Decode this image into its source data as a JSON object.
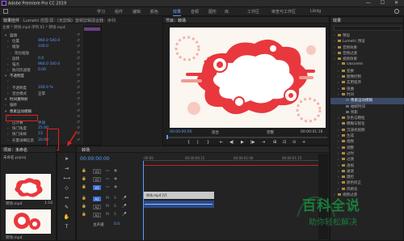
{
  "titlebar": {
    "app_title": "Adobe Premiere Pro CC 2019"
  },
  "workspaces": {
    "items": [
      "学习",
      "组件",
      "编辑",
      "颜色",
      "效果",
      "音频",
      "图形",
      "库",
      "工作区",
      "审查与工作区",
      "Liblig"
    ],
    "active_index": 4
  },
  "effect_controls": {
    "tabs": [
      "效果控件",
      "Lumetri 范围",
      "源：(无剪辑)",
      "音频剪辑混合器：序列"
    ],
    "clip_label": "主要 * 转场.mp4  序列 01 * 转场.mp4",
    "timecode_label": "0:00:00",
    "rows": [
      {
        "indent": 1,
        "label": "运动",
        "value": "",
        "section": true
      },
      {
        "indent": 2,
        "label": "位置",
        "value": "960.0  540.0"
      },
      {
        "indent": 2,
        "label": "缩放",
        "value": "100.0"
      },
      {
        "indent": 3,
        "label": "等比缩放",
        "value": ""
      },
      {
        "indent": 2,
        "label": "旋转",
        "value": "0.0"
      },
      {
        "indent": 2,
        "label": "锚点",
        "value": "960.0  540.0"
      },
      {
        "indent": 2,
        "label": "防闪烁滤镜",
        "value": "0.00"
      },
      {
        "indent": 1,
        "label": "不透明度",
        "value": "",
        "section": true
      },
      {
        "indent": 2,
        "label": "",
        "value": ""
      },
      {
        "indent": 2,
        "label": "不透明度",
        "value": "100.0 %"
      },
      {
        "indent": 2,
        "label": "混合模式",
        "value": "正常"
      },
      {
        "indent": 1,
        "label": "时间重映射",
        "value": "",
        "section": true
      },
      {
        "indent": 1,
        "label": "偏移",
        "value": ""
      },
      {
        "indent": 1,
        "label": "像素运动模糊",
        "value": "",
        "section": true
      },
      {
        "indent": 2,
        "label": "",
        "value": ""
      },
      {
        "indent": 2,
        "label": "已计算",
        "value": "手动"
      },
      {
        "indent": 2,
        "label": "快门角度",
        "value": "25.00"
      },
      {
        "indent": 2,
        "label": "快门采样",
        "value": "23"
      },
      {
        "indent": 2,
        "label": "矢量详细信息",
        "value": "20.00"
      }
    ]
  },
  "program_monitor": {
    "title": "节目：转场",
    "timecode_left": "00:00:00:00",
    "fit_label": "适合",
    "quality_label": "完整",
    "timecode_right": "00:00:01:16",
    "transport": [
      "{",
      "|",
      "}",
      "⇤",
      "◀|",
      "▶",
      "|▶",
      "⇥",
      "⊞",
      "⊡",
      "⊙",
      "+"
    ]
  },
  "effects": {
    "title": "效果",
    "items": [
      {
        "label": "预设",
        "kind": "folder",
        "indent": 0
      },
      {
        "label": "Lumetri 预设",
        "kind": "folder",
        "indent": 0
      },
      {
        "label": "音频效果",
        "kind": "folder",
        "indent": 0
      },
      {
        "label": "音频过渡",
        "kind": "folder",
        "indent": 0
      },
      {
        "label": "视频效果",
        "kind": "folder",
        "indent": 0
      },
      {
        "label": "Obsolete",
        "kind": "folder",
        "indent": 1
      },
      {
        "label": "变换",
        "kind": "folder",
        "indent": 1
      },
      {
        "label": "图像控制",
        "kind": "folder",
        "indent": 1
      },
      {
        "label": "实用程序",
        "kind": "folder",
        "indent": 1
      },
      {
        "label": "扭曲",
        "kind": "folder",
        "indent": 1
      },
      {
        "label": "时间",
        "kind": "folder",
        "indent": 1
      },
      {
        "label": "像素运动模糊",
        "kind": "fx",
        "indent": 2,
        "selected": true
      },
      {
        "label": "抽帧时间",
        "kind": "fx",
        "indent": 2
      },
      {
        "label": "残影",
        "kind": "fx",
        "indent": 2
      },
      {
        "label": "杂色与颗粒",
        "kind": "folder",
        "indent": 1
      },
      {
        "label": "模糊与锐化",
        "kind": "folder",
        "indent": 1
      },
      {
        "label": "沉浸式视频",
        "kind": "folder",
        "indent": 1
      },
      {
        "label": "生成",
        "kind": "folder",
        "indent": 1
      },
      {
        "label": "视频",
        "kind": "folder",
        "indent": 1
      },
      {
        "label": "调整",
        "kind": "folder",
        "indent": 1
      },
      {
        "label": "过时",
        "kind": "folder",
        "indent": 1
      },
      {
        "label": "过渡",
        "kind": "folder",
        "indent": 1
      },
      {
        "label": "透视",
        "kind": "folder",
        "indent": 1
      },
      {
        "label": "通道",
        "kind": "folder",
        "indent": 1
      },
      {
        "label": "键控",
        "kind": "folder",
        "indent": 1
      },
      {
        "label": "颜色校正",
        "kind": "folder",
        "indent": 1
      },
      {
        "label": "风格化",
        "kind": "folder",
        "indent": 1
      },
      {
        "label": "视频过渡",
        "kind": "folder",
        "indent": 0
      }
    ]
  },
  "project": {
    "tab": "项目：未命名",
    "path": "未命名.prproj",
    "item1": "转场.mp4",
    "item1_duration": "1:16",
    "item2": "转场.mp4"
  },
  "timeline": {
    "tab": "转场",
    "timecode": "00:00:00:00",
    "ruler_ticks": [
      ":00:00",
      "00:00:00:15",
      "00:00:01:00",
      "00:00:01:15"
    ],
    "tracks": [
      "V3",
      "V2",
      "V1",
      "A1",
      "A2",
      "A3"
    ],
    "master_label": "主声道",
    "master_value": "0.0",
    "clip_label": "转场.mp4 [V]"
  },
  "watermark": {
    "title": "百科全说",
    "subtitle": "助你轻松解决"
  }
}
